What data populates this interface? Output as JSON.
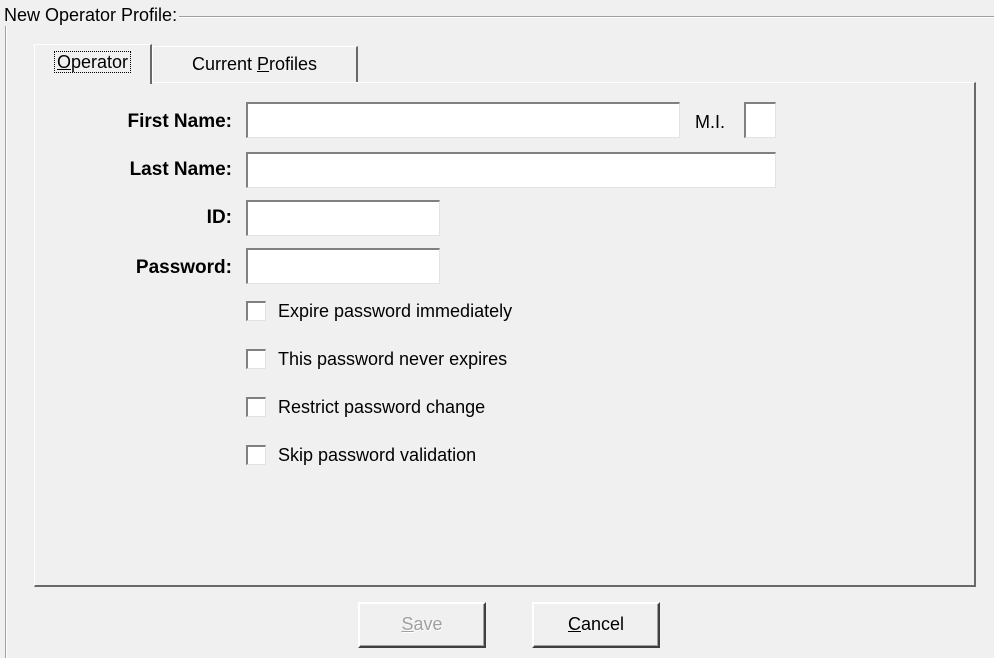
{
  "group": {
    "title": "New Operator Profile:"
  },
  "tabs": [
    {
      "label_pre": "",
      "label_ul": "O",
      "label_post": "perator",
      "active": true
    },
    {
      "label_pre": "Current ",
      "label_ul": "P",
      "label_post": "rofiles",
      "active": false
    }
  ],
  "form": {
    "first_name_label": "First Name:",
    "mi_label": "M.I.",
    "last_name_label": "Last Name:",
    "id_label": "ID:",
    "password_label": "Password:",
    "first_name_value": "",
    "mi_value": "",
    "last_name_value": "",
    "id_value": "",
    "password_value": ""
  },
  "checkboxes": [
    {
      "label": "Expire password immediately",
      "checked": false
    },
    {
      "label": "This password never expires",
      "checked": false
    },
    {
      "label": "Restrict password change",
      "checked": false
    },
    {
      "label": "Skip password validation",
      "checked": false
    }
  ],
  "buttons": {
    "save_ul": "S",
    "save_rest": "ave",
    "save_enabled": false,
    "cancel_ul": "C",
    "cancel_rest": "ancel",
    "cancel_enabled": true
  }
}
